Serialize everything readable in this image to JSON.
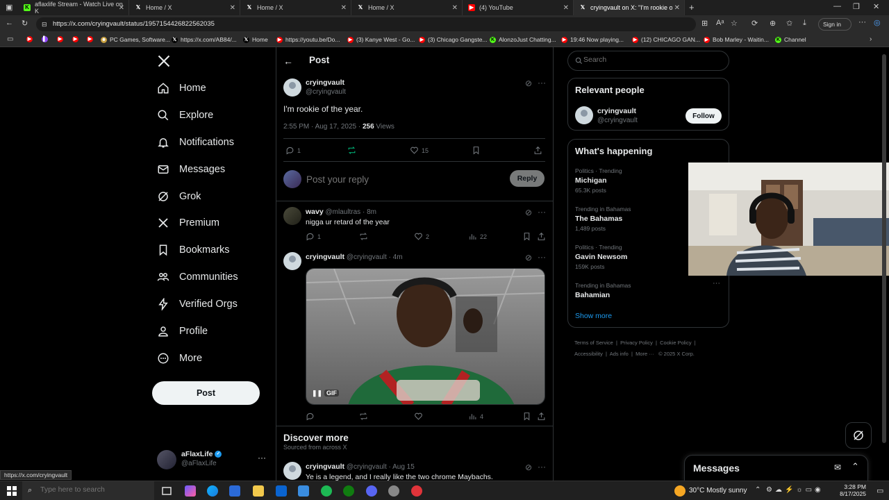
{
  "browser": {
    "tabs": [
      {
        "title": "aflaxlife Stream - Watch Live on K",
        "favicon": "kick-icon"
      },
      {
        "title": "Home / X",
        "favicon": "x-icon"
      },
      {
        "title": "Home / X",
        "favicon": "x-icon"
      },
      {
        "title": "Home / X",
        "favicon": "x-icon"
      },
      {
        "title": "(4) YouTube",
        "favicon": "youtube-icon"
      },
      {
        "title": "cryingvault on X: \"I'm rookie of th",
        "favicon": "x-icon"
      }
    ],
    "url": "https://x.com/cryingvault/status/1957154426822562035",
    "signin_label": "Sign in",
    "bookmarks": [
      "PC Games, Software...",
      "https://x.com/AB84/...",
      "Home",
      "https://youtu.be/Do...",
      "(3) Kanye West - Go...",
      "(3) Chicago Gangste...",
      "AlonzoJust Chatting...",
      "19:46 Now playing...",
      "(12) CHICAGO GAN...",
      "Bob Marley - Waitin...",
      "Channel"
    ],
    "status_url": "https://x.com/cryingvault"
  },
  "nav": {
    "items": [
      {
        "label": "Home",
        "icon": "home-icon"
      },
      {
        "label": "Explore",
        "icon": "search-icon"
      },
      {
        "label": "Notifications",
        "icon": "bell-icon"
      },
      {
        "label": "Messages",
        "icon": "envelope-icon"
      },
      {
        "label": "Grok",
        "icon": "grok-icon"
      },
      {
        "label": "Premium",
        "icon": "x-logo-icon"
      },
      {
        "label": "Bookmarks",
        "icon": "bookmark-icon"
      },
      {
        "label": "Communities",
        "icon": "people-icon"
      },
      {
        "label": "Verified Orgs",
        "icon": "lightning-icon"
      },
      {
        "label": "Profile",
        "icon": "person-icon"
      },
      {
        "label": "More",
        "icon": "more-circle-icon"
      }
    ],
    "post_label": "Post",
    "account": {
      "name": "aFlaxLife",
      "handle": "@aFlaxLife"
    }
  },
  "main": {
    "header_title": "Post",
    "tweet": {
      "name": "cryingvault",
      "handle": "@cryingvault",
      "text": "I'm rookie of the year.",
      "time": "2:55 PM · Aug 17, 2025 · ",
      "views_count": "256",
      "views_label": " Views",
      "replies": "1",
      "likes": "15"
    },
    "reply_placeholder": "Post your reply",
    "reply_button": "Reply",
    "replies": [
      {
        "name": "wavy",
        "handle": "@mlaultras · 8m",
        "text": "nigga ur retard of the year",
        "replies": "1",
        "likes": "2",
        "views": "22"
      },
      {
        "name": "cryingvault",
        "handle": "@cryingvault · 4m",
        "gif_label": "GIF",
        "views": "4"
      }
    ],
    "discover_title": "Discover more",
    "discover_sub": "Sourced from across X",
    "discover_post": {
      "name": "cryingvault",
      "handle": "@cryingvault · Aug 15",
      "text": "Ye is a legend, and I really like the two chrome Maybachs."
    }
  },
  "sidebar": {
    "search_placeholder": "Search",
    "relevant_title": "Relevant people",
    "relevant_person": {
      "name": "cryingvault",
      "handle": "@cryingvault",
      "follow_label": "Follow"
    },
    "happening_title": "What's happening",
    "trends": [
      {
        "meta": "Politics · Trending",
        "title": "Michigan",
        "count": "65.3K posts"
      },
      {
        "meta": "Trending in Bahamas",
        "title": "The Bahamas",
        "count": "1,489 posts"
      },
      {
        "meta": "Politics · Trending",
        "title": "Gavin Newsom",
        "count": "159K posts"
      },
      {
        "meta": "Trending in Bahamas",
        "title": "Bahamian",
        "count": ""
      }
    ],
    "show_more": "Show more",
    "footer": [
      "Terms of Service",
      "Privacy Policy",
      "Cookie Policy",
      "Accessibility",
      "Ads info",
      "More ···",
      "© 2025 X Corp."
    ],
    "messages_title": "Messages"
  },
  "taskbar": {
    "search_placeholder": "Type here to search",
    "weather": "30°C  Mostly sunny",
    "time": "3:28 PM",
    "date": "8/17/2025"
  }
}
